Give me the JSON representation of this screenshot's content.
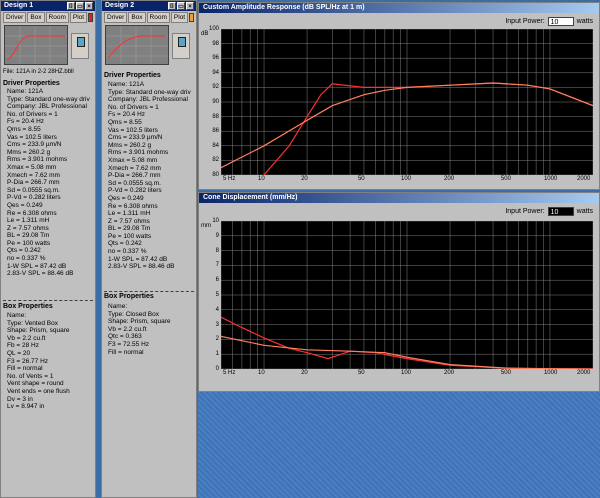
{
  "design1": {
    "title": "Design 1",
    "tabs": [
      "Driver",
      "Box",
      "Room",
      "Plot"
    ],
    "swatch_color": "#e02020",
    "file": "File: 121A in 2-2 28HZ.bbll",
    "driver_header": "Driver Properties",
    "driver_lines": [
      "Name: 121A",
      "Type: Standard one-way driv",
      "Company: JBL Professional",
      "No. of Drivers = 1",
      "Fs = 20.4 Hz",
      "Qms = 8.55",
      "Vas = 102.5 liters",
      "Cms = 233.9 µm/N",
      "Mms = 260.2 g",
      "Rms = 3.901 mohms",
      "Xmax = 5.08 mm",
      "Xmech = 7.62 mm",
      "P-Dia = 266.7 mm",
      "Sd = 0.0555 sq.m.",
      "P-Vd = 0.282 liters",
      "Qes = 0.249",
      "Re = 6.308 ohms",
      "Le = 1.311 mH",
      "Z = 7.57 ohms",
      "BL = 29.08 Tm",
      "Pe = 100 watts",
      "Qts = 0.242",
      "no = 0.337 %",
      "1-W SPL = 87.42 dB",
      "2.83-V SPL = 88.46 dB"
    ],
    "box_header": "Box Properties",
    "box_lines": [
      "Name:",
      "Type: Vented Box",
      "Shape: Prism, square",
      "Vb = 2.2 cu.ft",
      "Fb = 28 Hz",
      "QL = 20",
      "F3 = 26.77 Hz",
      "Fill = normal",
      "No. of Vents = 1",
      "  Vent shape = round",
      "  Vent ends = one flush",
      "  Dv = 3 in",
      "  Lv = 8.947 in"
    ]
  },
  "design2": {
    "title": "Design 2",
    "tabs": [
      "Driver",
      "Box",
      "Room",
      "Plot"
    ],
    "swatch_color": "#f0a030",
    "driver_header": "Driver Properties",
    "driver_lines": [
      "Name: 121A",
      "Type: Standard one-way driv",
      "Company: JBL Professional",
      "No. of Drivers = 1",
      "Fs = 20.4 Hz",
      "Qms = 8.55",
      "Vas = 102.5 liters",
      "Cms = 233.9 µm/N",
      "Mms = 260.2 g",
      "Rms = 3.901 mohms",
      "Xmax = 5.08 mm",
      "Xmech = 7.62 mm",
      "P-Dia = 266.7 mm",
      "Sd = 0.0555 sq.m.",
      "P-Vd = 0.282 liters",
      "Qes = 0.249",
      "Re = 6.308 ohms",
      "Le = 1.311 mH",
      "Z = 7.57 ohms",
      "BL = 29.08 Tm",
      "Pe = 100 watts",
      "Qts = 0.242",
      "no = 0.337 %",
      "1-W SPL = 87.42 dB",
      "2.83-V SPL = 88.46 dB"
    ],
    "box_header": "Box Properties",
    "box_lines": [
      "Name:",
      "Type: Closed Box",
      "Shape: Prism, square",
      "Vb = 2.2 cu.ft",
      "Qtc = 0.363",
      "F3 = 72.55 Hz",
      "Fill = normal"
    ]
  },
  "amp_window": {
    "title": "Custom Amplitude Response (dB SPL/Hz at 1 m)",
    "input_label": "Input Power:",
    "input_value": "10",
    "unit": "watts",
    "ylabel": "dB",
    "yticks": [
      "100",
      "98",
      "96",
      "94",
      "92",
      "90",
      "88",
      "86",
      "84",
      "82",
      "80"
    ],
    "xticks": [
      "5 Hz",
      "10",
      "20",
      "50",
      "100",
      "200",
      "500",
      "1000",
      "2000"
    ]
  },
  "cone_window": {
    "title": "Cone Displacement (mm/Hz)",
    "input_label": "Input Power:",
    "input_value": "10",
    "unit": "watts",
    "ylabel": "mm",
    "yticks": [
      "10",
      "9",
      "8",
      "7",
      "6",
      "5",
      "4",
      "3",
      "2",
      "1",
      "0"
    ],
    "xticks": [
      "5 Hz",
      "10",
      "20",
      "50",
      "100",
      "200",
      "500",
      "1000",
      "2000"
    ]
  },
  "chart_data": [
    {
      "type": "line",
      "title": "Custom Amplitude Response (dB SPL/Hz at 1 m)",
      "ylabel": "dB",
      "log_x": true,
      "xlim": [
        5,
        2000
      ],
      "ylim": [
        80,
        100
      ],
      "series": [
        {
          "color": "#ff3030",
          "x": [
            10,
            15,
            20,
            25,
            30,
            40,
            50,
            70,
            100,
            200,
            400,
            700,
            1000,
            2000
          ],
          "y": [
            80,
            84,
            88,
            91,
            92.5,
            92.2,
            92,
            92,
            92,
            92.3,
            92.6,
            92.3,
            91.8,
            89.5
          ]
        },
        {
          "color": "#ff8060",
          "x": [
            5,
            10,
            20,
            30,
            50,
            70,
            100,
            200,
            400,
            700,
            1000,
            2000
          ],
          "y": [
            81,
            84,
            87.5,
            89.5,
            91,
            91.6,
            92,
            92.3,
            92.6,
            92.3,
            91.8,
            89.5
          ]
        }
      ]
    },
    {
      "type": "line",
      "title": "Cone Displacement (mm/Hz)",
      "ylabel": "mm",
      "log_x": true,
      "xlim": [
        5,
        2000
      ],
      "ylim": [
        0,
        10
      ],
      "series": [
        {
          "color": "#ff3030",
          "x": [
            5,
            7,
            10,
            15,
            20,
            28,
            40,
            60,
            100,
            200,
            500,
            1000,
            2000
          ],
          "y": [
            3.5,
            2.8,
            2.1,
            1.4,
            1.1,
            0.7,
            1.2,
            1.1,
            0.7,
            0.25,
            0.05,
            0.02,
            0.0
          ]
        },
        {
          "color": "#ff8060",
          "x": [
            5,
            10,
            20,
            40,
            70,
            100,
            200,
            500,
            1000,
            2000
          ],
          "y": [
            2.2,
            1.6,
            1.3,
            1.2,
            1.1,
            0.8,
            0.3,
            0.06,
            0.02,
            0.0
          ]
        }
      ]
    }
  ]
}
